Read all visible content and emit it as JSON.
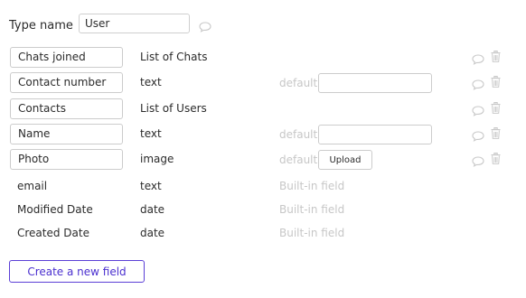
{
  "type_name": {
    "label": "Type name",
    "value": "User"
  },
  "fields": [
    {
      "name": "Chats joined",
      "type": "List of Chats",
      "default_label": "",
      "default_control": "none"
    },
    {
      "name": "Contact number",
      "type": "text",
      "default_label": "default",
      "default_control": "input"
    },
    {
      "name": "Contacts",
      "type": "List of Users",
      "default_label": "",
      "default_control": "none"
    },
    {
      "name": "Name",
      "type": "text",
      "default_label": "default",
      "default_control": "input"
    },
    {
      "name": "Photo",
      "type": "image",
      "default_label": "default",
      "default_control": "upload",
      "upload_label": "Upload"
    }
  ],
  "builtin_fields": [
    {
      "name": "email",
      "type": "text",
      "note": "Built-in field"
    },
    {
      "name": "Modified Date",
      "type": "date",
      "note": "Built-in field"
    },
    {
      "name": "Created Date",
      "type": "date",
      "note": "Built-in field"
    }
  ],
  "create_button_label": "Create a new field",
  "icons": {
    "comment": "comment-bubble-icon",
    "trash": "trash-icon"
  },
  "colors": {
    "accent": "#4a2fcf",
    "muted_text": "#c7c7c7",
    "icon": "#c9c9c9"
  }
}
